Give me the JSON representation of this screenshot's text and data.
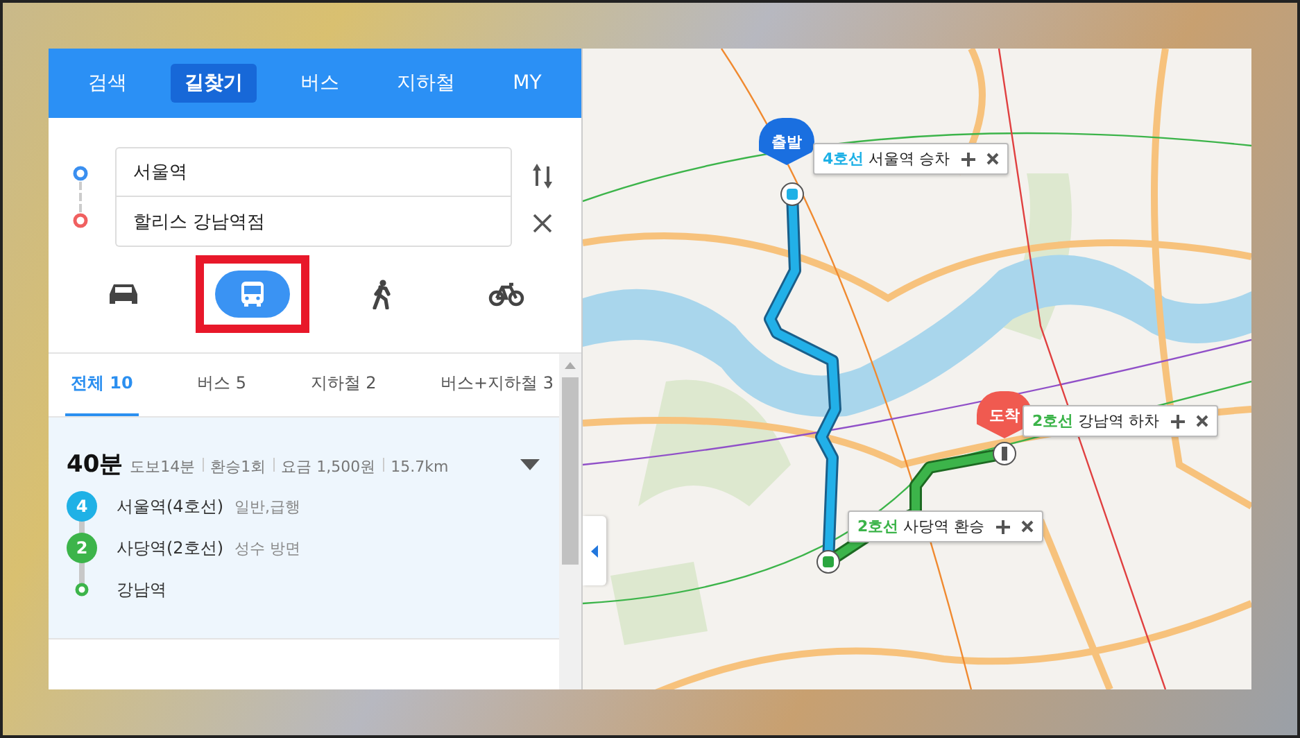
{
  "tabs": [
    {
      "label": "검색",
      "selected": false
    },
    {
      "label": "길찾기",
      "selected": true
    },
    {
      "label": "버스",
      "selected": false
    },
    {
      "label": "지하철",
      "selected": false
    },
    {
      "label": "MY",
      "selected": false
    }
  ],
  "route_inputs": {
    "origin": "서울역",
    "destination": "할리스 강남역점"
  },
  "modes": [
    {
      "kind": "car",
      "selected": false
    },
    {
      "kind": "transit",
      "selected": true
    },
    {
      "kind": "walk",
      "selected": false
    },
    {
      "kind": "bike",
      "selected": false
    }
  ],
  "result_tabs": [
    {
      "label": "전체 10",
      "selected": true
    },
    {
      "label": "버스 5",
      "selected": false
    },
    {
      "label": "지하철 2",
      "selected": false
    },
    {
      "label": "버스+지하철 3",
      "selected": false
    }
  ],
  "routes": [
    {
      "duration": "40분",
      "selected": true,
      "details": [
        "도보14분",
        "환승1회",
        "요금 1,500원",
        "15.7km"
      ],
      "steps": [
        {
          "kind": "line",
          "badge": "4",
          "color": "#1fb1e6",
          "station": "서울역(4호선)",
          "note": "일반,급행"
        },
        {
          "kind": "line",
          "badge": "2",
          "color": "#3cb44a",
          "station": "사당역(2호선)",
          "note": "성수 방면"
        },
        {
          "kind": "end",
          "color": "#3cb44a",
          "station": "강남역"
        }
      ]
    }
  ],
  "map": {
    "pins": [
      {
        "kind": "start",
        "label": "출발"
      },
      {
        "kind": "end",
        "label": "도착"
      }
    ],
    "callouts": [
      {
        "kind": "board",
        "line": "4호선",
        "color": "#1fb1e6",
        "text": "서울역 승차"
      },
      {
        "kind": "transfer",
        "line": "2호선",
        "color": "#3cb44a",
        "text": "사당역 환승"
      },
      {
        "kind": "alight",
        "line": "2호선",
        "color": "#3cb44a",
        "text": "강남역 하차"
      }
    ]
  }
}
